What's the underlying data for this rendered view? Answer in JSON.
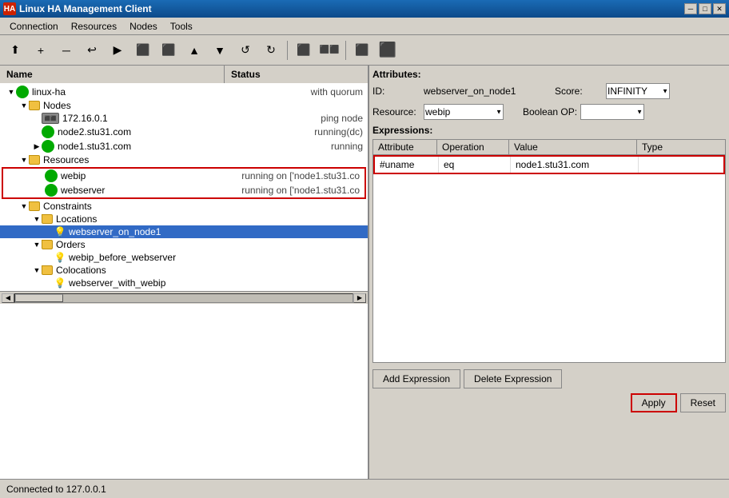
{
  "window": {
    "title": "Linux HA Management Client",
    "icon": "HA"
  },
  "titlebar": {
    "minimize": "─",
    "maximize": "□",
    "close": "✕"
  },
  "menubar": {
    "items": [
      "Connection",
      "Resources",
      "Nodes",
      "Tools"
    ]
  },
  "toolbar": {
    "buttons": [
      "⬆",
      "+",
      "─",
      "↩",
      "▶",
      "⬛",
      "⬛",
      "▲",
      "▼",
      "↺",
      "↻",
      "⬛",
      "⬛⬛",
      "⬛",
      "⬛",
      "⬛"
    ]
  },
  "leftpanel": {
    "header": "Name",
    "status_header": "Status",
    "tree": [
      {
        "id": "linux-ha",
        "label": "linux-ha",
        "status": "with quorum",
        "indent": 0,
        "type": "green",
        "expanded": true
      },
      {
        "id": "nodes",
        "label": "Nodes",
        "status": "",
        "indent": 1,
        "type": "folder",
        "expanded": true
      },
      {
        "id": "172.16.0.1",
        "label": "172.16.0.1",
        "status": "ping node",
        "indent": 2,
        "type": "server"
      },
      {
        "id": "node2",
        "label": "node2.stu31.com",
        "status": "running(dc)",
        "indent": 2,
        "type": "green"
      },
      {
        "id": "node1",
        "label": "node1.stu31.com",
        "status": "running",
        "indent": 2,
        "type": "green"
      },
      {
        "id": "resources",
        "label": "Resources",
        "status": "",
        "indent": 1,
        "type": "folder",
        "expanded": true
      },
      {
        "id": "webip",
        "label": "webip",
        "status": "running on ['node1.stu31.co",
        "indent": 2,
        "type": "green",
        "highlighted": true
      },
      {
        "id": "webserver",
        "label": "webserver",
        "status": "running on ['node1.stu31.co",
        "indent": 2,
        "type": "green",
        "highlighted": true
      },
      {
        "id": "constraints",
        "label": "Constraints",
        "status": "",
        "indent": 1,
        "type": "folder",
        "expanded": true
      },
      {
        "id": "locations",
        "label": "Locations",
        "status": "",
        "indent": 2,
        "type": "folder",
        "expanded": true
      },
      {
        "id": "webserver_on_node1",
        "label": "webserver_on_node1",
        "status": "",
        "indent": 3,
        "type": "bulb",
        "selected": true
      },
      {
        "id": "orders",
        "label": "Orders",
        "status": "",
        "indent": 2,
        "type": "folder",
        "expanded": true
      },
      {
        "id": "webip_before_webserver",
        "label": "webip_before_webserver",
        "status": "",
        "indent": 3,
        "type": "bulb"
      },
      {
        "id": "colocations",
        "label": "Colocations",
        "status": "",
        "indent": 2,
        "type": "folder",
        "expanded": true
      },
      {
        "id": "webserver_with_webip",
        "label": "webserver_with_webip",
        "status": "",
        "indent": 3,
        "type": "bulb"
      }
    ]
  },
  "rightpanel": {
    "section_title": "Attributes:",
    "id_label": "ID:",
    "id_value": "webserver_on_node1",
    "score_label": "Score:",
    "score_value": "INFINITY",
    "resource_label": "Resource:",
    "resource_value": "webip",
    "boolean_op_label": "Boolean OP:",
    "boolean_op_value": "",
    "expressions_title": "Expressions:",
    "table": {
      "headers": [
        "Attribute",
        "Operation",
        "Value",
        "Type"
      ],
      "rows": [
        {
          "attribute": "#uname",
          "operation": "eq",
          "value": "node1.stu31.com",
          "type": ""
        }
      ]
    },
    "buttons": {
      "add_expression": "Add Expression",
      "delete_expression": "Delete Expression",
      "apply": "Apply",
      "reset": "Reset"
    }
  },
  "statusbar": {
    "text": "Connected to 127.0.0.1"
  }
}
